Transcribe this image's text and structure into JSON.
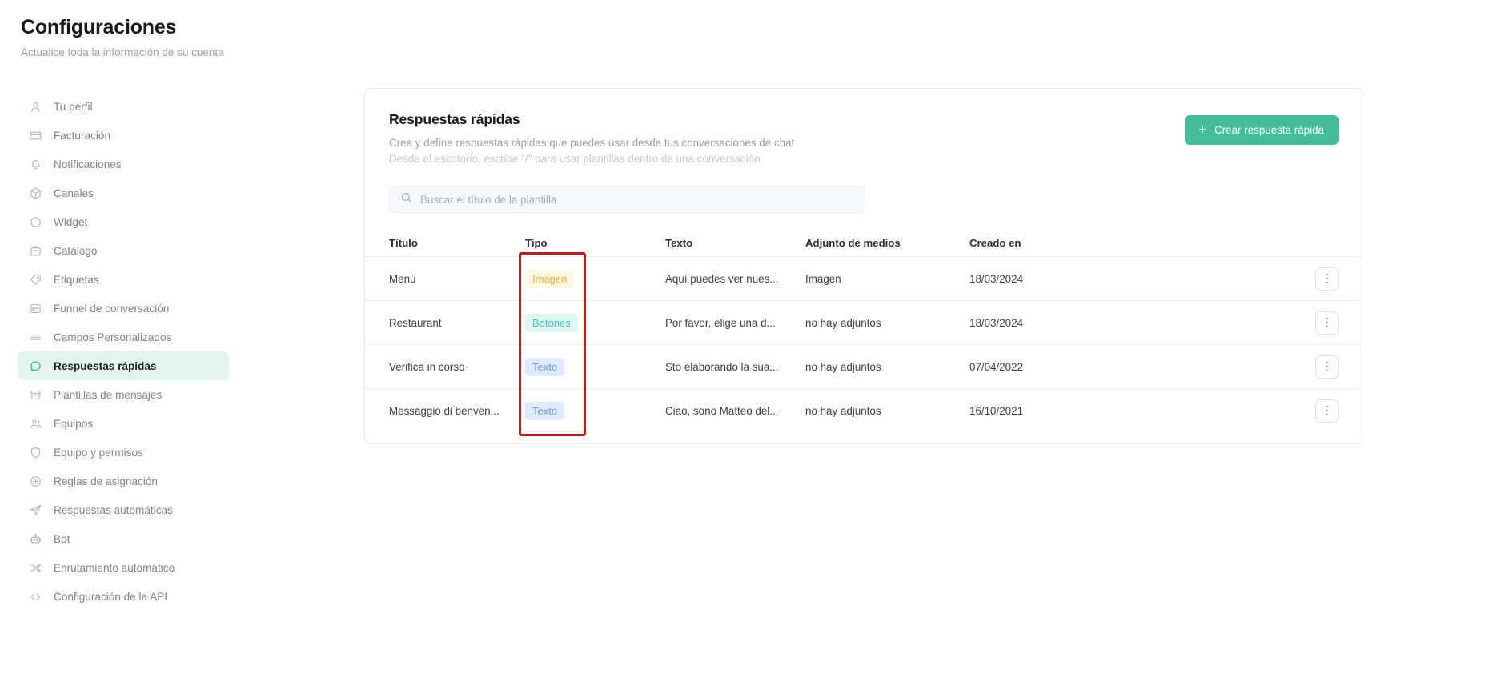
{
  "header": {
    "title": "Configuraciones",
    "subtitle": "Actualice toda la información de su cuenta"
  },
  "sidebar": {
    "items": [
      {
        "label": "Tu perfil",
        "icon": "user-icon",
        "active": false
      },
      {
        "label": "Facturación",
        "icon": "credit-card-icon",
        "active": false
      },
      {
        "label": "Notificaciones",
        "icon": "bell-icon",
        "active": false
      },
      {
        "label": "Canales",
        "icon": "cube-icon",
        "active": false
      },
      {
        "label": "Widget",
        "icon": "circle-icon",
        "active": false
      },
      {
        "label": "Catálogo",
        "icon": "bag-icon",
        "active": false
      },
      {
        "label": "Etiquetas",
        "icon": "tag-icon",
        "active": false
      },
      {
        "label": "Funnel de conversación",
        "icon": "funnel-board-icon",
        "active": false
      },
      {
        "label": "Campos Personalizados",
        "icon": "list-lines-icon",
        "active": false
      },
      {
        "label": "Respuestas rápidas",
        "icon": "chat-bubble-icon",
        "active": true
      },
      {
        "label": "Plantillas de mensajes",
        "icon": "archive-box-icon",
        "active": false
      },
      {
        "label": "Equipos",
        "icon": "users-icon",
        "active": false
      },
      {
        "label": "Equipo y permisos",
        "icon": "shield-icon",
        "active": false
      },
      {
        "label": "Reglas de asignación",
        "icon": "plus-circle-icon",
        "active": false
      },
      {
        "label": "Respuestas automáticas",
        "icon": "paper-plane-icon",
        "active": false
      },
      {
        "label": "Bot",
        "icon": "robot-icon",
        "active": false
      },
      {
        "label": "Enrutamiento automático",
        "icon": "shuffle-icon",
        "active": false
      },
      {
        "label": "Configuración de la API",
        "icon": "code-brackets-icon",
        "active": false
      }
    ]
  },
  "card": {
    "title": "Respuestas rápidas",
    "description": "Crea y define respuestas rápidas que puedes usar desde tus conversaciones de chat",
    "description2": "Desde el escritorio, escribe \"/\" para usar plantillas dentro de una conversación",
    "create_button": {
      "label": "Crear respuesta rápida",
      "plus": "+",
      "color": "#42bd97"
    },
    "search": {
      "placeholder": "Buscar el título de la plantilla",
      "value": ""
    },
    "table": {
      "columns": [
        "Título",
        "Tipo",
        "Texto",
        "Adjunto de medios",
        "Creado en"
      ],
      "rows": [
        {
          "titulo": "Menú",
          "tipo": "Imagen",
          "tipo_style": "imagen",
          "texto": "Aquí puedes ver nues...",
          "adjunto": "Imagen",
          "creado": "18/03/2024"
        },
        {
          "titulo": "Restaurant",
          "tipo": "Botones",
          "tipo_style": "botones",
          "texto": "Por favor, elige una d...",
          "adjunto": "no hay adjuntos",
          "creado": "18/03/2024"
        },
        {
          "titulo": "Verifica in corso",
          "tipo": "Texto",
          "tipo_style": "texto",
          "texto": "Sto elaborando la sua...",
          "adjunto": "no hay adjuntos",
          "creado": "07/04/2022"
        },
        {
          "titulo": "Messaggio di benven...",
          "tipo": "Texto",
          "tipo_style": "texto",
          "texto": "Ciao, sono Matteo del...",
          "adjunto": "no hay adjuntos",
          "creado": "16/10/2021"
        }
      ]
    }
  },
  "annotation": {
    "color": "#c21a1a",
    "target": "tipo-column"
  },
  "badge_colors": {
    "imagen_bg": "#fdf6e0",
    "imagen_fg": "#e8b33f",
    "botones_bg": "#ddf7f3",
    "botones_fg": "#49bfb3",
    "texto_bg": "#dfeafc",
    "texto_fg": "#6e9ae8"
  }
}
